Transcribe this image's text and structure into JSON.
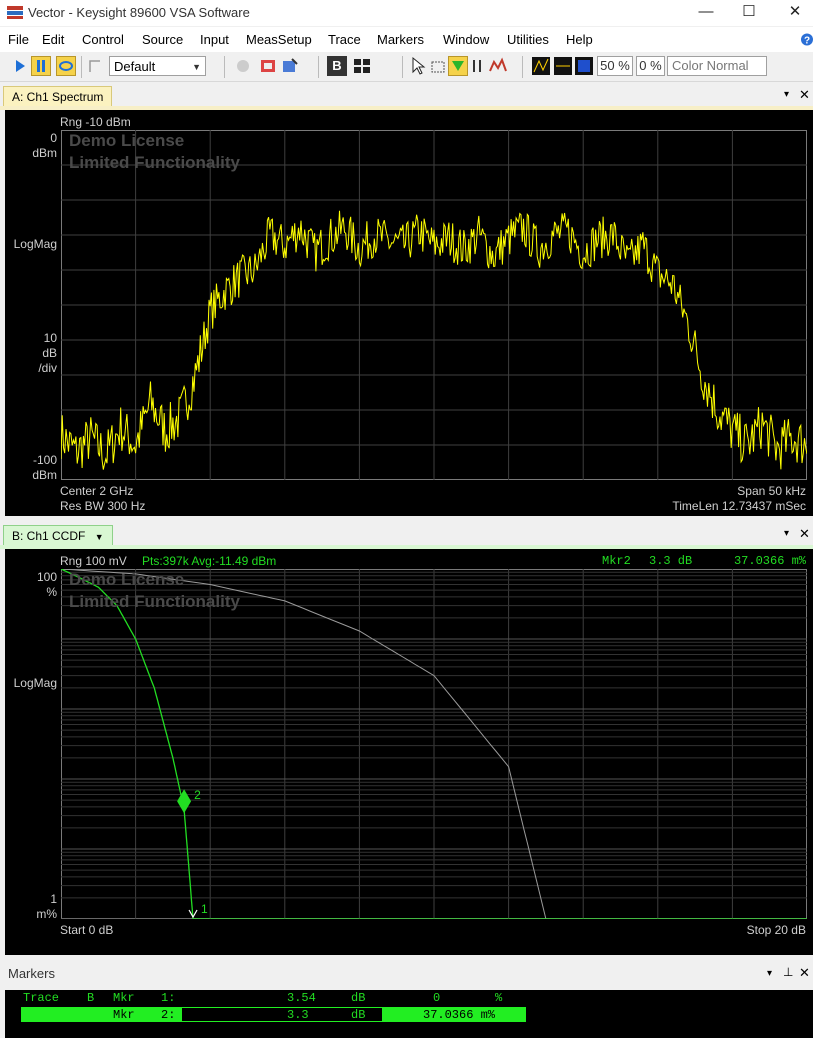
{
  "window": {
    "title": "Vector - Keysight 89600 VSA Software",
    "minimize": "—",
    "maximize": "☐",
    "close": "✕"
  },
  "menu": [
    "File",
    "Edit",
    "Control",
    "Source",
    "Input",
    "MeasSetup",
    "Trace",
    "Markers",
    "Window",
    "Utilities",
    "Help"
  ],
  "toolbar": {
    "preset": "Default",
    "pct1": "50 %",
    "pct2": "0 %",
    "color_mode": "Color Normal"
  },
  "trace_a": {
    "tab": "A: Ch1 Spectrum",
    "range": "Rng -10 dBm",
    "watermark1": "Demo License",
    "watermark2": "Limited Functionality",
    "ytop_value": "0",
    "ytop_unit": "dBm",
    "format": "LogMag",
    "scale_value": "10",
    "scale_unit": "dB",
    "scale_per": "/div",
    "ybot_value": "-100",
    "ybot_unit": "dBm",
    "center": "Center 2 GHz",
    "span": "Span 50 kHz",
    "rbw": "Res BW 300  Hz",
    "timelen": "TimeLen 12.73437 mSec"
  },
  "trace_b": {
    "tab": "B: Ch1 CCDF",
    "dropdown": "▼",
    "range": "Rng 100 mV",
    "stats": "Pts:397k Avg:-11.49 dBm",
    "marker_readout_label": "Mkr2",
    "marker_readout_x": "3.3 dB",
    "marker_readout_y": "37.0366 m%",
    "watermark1": "Demo License",
    "watermark2": "Limited Functionality",
    "ytop_value": "100",
    "ytop_unit": "%",
    "format": "LogMag",
    "ybot_value": "1",
    "ybot_unit": "m%",
    "start": "Start 0 dB",
    "stop": "Stop 20 dB",
    "marker1_label": "1",
    "marker2_label": "2"
  },
  "markers_panel": {
    "title": "Markers",
    "header": [
      "Trace",
      "B",
      "Mkr",
      "1:",
      "3.54",
      "dB",
      "0",
      "%"
    ],
    "row2": [
      "Mkr",
      "2:",
      "3.3",
      "dB",
      "37.0366 m%"
    ]
  },
  "chart_data": [
    {
      "type": "line",
      "title": "A: Ch1 Spectrum",
      "xlabel": "",
      "ylabel": "LogMag",
      "x_center": "2 GHz",
      "x_span": "50 kHz",
      "ylim": [
        -100,
        0
      ],
      "y_unit": "dBm",
      "grid": true,
      "series": [
        {
          "x_khz": [
            -25,
            -24,
            -23,
            -22,
            -21,
            -20,
            -19,
            -18,
            -17,
            -16,
            -15,
            -14,
            -13,
            -12,
            -11,
            -10,
            -9,
            -8,
            -7,
            -6,
            -5,
            -4,
            -3,
            -2,
            -1,
            0,
            1,
            2,
            3,
            4,
            5,
            6,
            7,
            8,
            9,
            10,
            11,
            12,
            13,
            14,
            15,
            16,
            17,
            18,
            19,
            20,
            21,
            22,
            23,
            24,
            25
          ],
          "values": [
            -87,
            -92,
            -88,
            -93,
            -85,
            -90,
            -78,
            -86,
            -82,
            -70,
            -52,
            -46,
            -42,
            -40,
            -30,
            -33,
            -28,
            -35,
            -31,
            -28,
            -34,
            -30,
            -32,
            -33,
            -29,
            -33,
            -31,
            -34,
            -30,
            -36,
            -31,
            -28,
            -34,
            -30,
            -29,
            -35,
            -31,
            -30,
            -38,
            -33,
            -41,
            -44,
            -55,
            -70,
            -80,
            -86,
            -90,
            -84,
            -91,
            -88,
            -90
          ]
        }
      ]
    },
    {
      "type": "line",
      "title": "B: Ch1 CCDF",
      "xlabel": "dB",
      "ylabel": "LogMag",
      "xlim": [
        0,
        20
      ],
      "y_scale": "log",
      "ylim_percent": [
        0.001,
        100
      ],
      "grid": true,
      "series": [
        {
          "x": [
            0,
            0.5,
            1,
            1.5,
            2,
            2.5,
            3,
            3.3,
            3.54
          ],
          "y_percent": [
            100,
            75,
            55,
            30,
            10,
            2,
            0.2,
            0.0370366,
            0.001
          ]
        },
        {
          "x": [
            0,
            2,
            4,
            6,
            8,
            10,
            12,
            13
          ],
          "y_percent": [
            100,
            85,
            60,
            35,
            13,
            3,
            0.15,
            0.001
          ]
        }
      ],
      "markers": [
        {
          "label": "1",
          "x": 3.54,
          "y": "0 %"
        },
        {
          "label": "2",
          "x": 3.3,
          "y": "37.0366 m%"
        }
      ]
    }
  ]
}
